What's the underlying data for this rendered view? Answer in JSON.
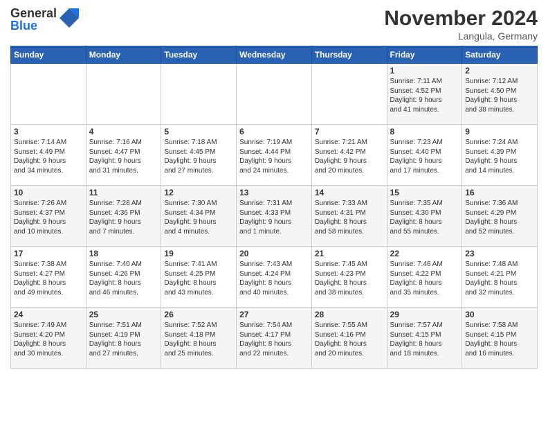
{
  "logo": {
    "general": "General",
    "blue": "Blue"
  },
  "header": {
    "month": "November 2024",
    "location": "Langula, Germany"
  },
  "weekdays": [
    "Sunday",
    "Monday",
    "Tuesday",
    "Wednesday",
    "Thursday",
    "Friday",
    "Saturday"
  ],
  "weeks": [
    [
      {
        "day": "",
        "info": ""
      },
      {
        "day": "",
        "info": ""
      },
      {
        "day": "",
        "info": ""
      },
      {
        "day": "",
        "info": ""
      },
      {
        "day": "",
        "info": ""
      },
      {
        "day": "1",
        "info": "Sunrise: 7:11 AM\nSunset: 4:52 PM\nDaylight: 9 hours\nand 41 minutes."
      },
      {
        "day": "2",
        "info": "Sunrise: 7:12 AM\nSunset: 4:50 PM\nDaylight: 9 hours\nand 38 minutes."
      }
    ],
    [
      {
        "day": "3",
        "info": "Sunrise: 7:14 AM\nSunset: 4:49 PM\nDaylight: 9 hours\nand 34 minutes."
      },
      {
        "day": "4",
        "info": "Sunrise: 7:16 AM\nSunset: 4:47 PM\nDaylight: 9 hours\nand 31 minutes."
      },
      {
        "day": "5",
        "info": "Sunrise: 7:18 AM\nSunset: 4:45 PM\nDaylight: 9 hours\nand 27 minutes."
      },
      {
        "day": "6",
        "info": "Sunrise: 7:19 AM\nSunset: 4:44 PM\nDaylight: 9 hours\nand 24 minutes."
      },
      {
        "day": "7",
        "info": "Sunrise: 7:21 AM\nSunset: 4:42 PM\nDaylight: 9 hours\nand 20 minutes."
      },
      {
        "day": "8",
        "info": "Sunrise: 7:23 AM\nSunset: 4:40 PM\nDaylight: 9 hours\nand 17 minutes."
      },
      {
        "day": "9",
        "info": "Sunrise: 7:24 AM\nSunset: 4:39 PM\nDaylight: 9 hours\nand 14 minutes."
      }
    ],
    [
      {
        "day": "10",
        "info": "Sunrise: 7:26 AM\nSunset: 4:37 PM\nDaylight: 9 hours\nand 10 minutes."
      },
      {
        "day": "11",
        "info": "Sunrise: 7:28 AM\nSunset: 4:36 PM\nDaylight: 9 hours\nand 7 minutes."
      },
      {
        "day": "12",
        "info": "Sunrise: 7:30 AM\nSunset: 4:34 PM\nDaylight: 9 hours\nand 4 minutes."
      },
      {
        "day": "13",
        "info": "Sunrise: 7:31 AM\nSunset: 4:33 PM\nDaylight: 9 hours\nand 1 minute."
      },
      {
        "day": "14",
        "info": "Sunrise: 7:33 AM\nSunset: 4:31 PM\nDaylight: 8 hours\nand 58 minutes."
      },
      {
        "day": "15",
        "info": "Sunrise: 7:35 AM\nSunset: 4:30 PM\nDaylight: 8 hours\nand 55 minutes."
      },
      {
        "day": "16",
        "info": "Sunrise: 7:36 AM\nSunset: 4:29 PM\nDaylight: 8 hours\nand 52 minutes."
      }
    ],
    [
      {
        "day": "17",
        "info": "Sunrise: 7:38 AM\nSunset: 4:27 PM\nDaylight: 8 hours\nand 49 minutes."
      },
      {
        "day": "18",
        "info": "Sunrise: 7:40 AM\nSunset: 4:26 PM\nDaylight: 8 hours\nand 46 minutes."
      },
      {
        "day": "19",
        "info": "Sunrise: 7:41 AM\nSunset: 4:25 PM\nDaylight: 8 hours\nand 43 minutes."
      },
      {
        "day": "20",
        "info": "Sunrise: 7:43 AM\nSunset: 4:24 PM\nDaylight: 8 hours\nand 40 minutes."
      },
      {
        "day": "21",
        "info": "Sunrise: 7:45 AM\nSunset: 4:23 PM\nDaylight: 8 hours\nand 38 minutes."
      },
      {
        "day": "22",
        "info": "Sunrise: 7:46 AM\nSunset: 4:22 PM\nDaylight: 8 hours\nand 35 minutes."
      },
      {
        "day": "23",
        "info": "Sunrise: 7:48 AM\nSunset: 4:21 PM\nDaylight: 8 hours\nand 32 minutes."
      }
    ],
    [
      {
        "day": "24",
        "info": "Sunrise: 7:49 AM\nSunset: 4:20 PM\nDaylight: 8 hours\nand 30 minutes."
      },
      {
        "day": "25",
        "info": "Sunrise: 7:51 AM\nSunset: 4:19 PM\nDaylight: 8 hours\nand 27 minutes."
      },
      {
        "day": "26",
        "info": "Sunrise: 7:52 AM\nSunset: 4:18 PM\nDaylight: 8 hours\nand 25 minutes."
      },
      {
        "day": "27",
        "info": "Sunrise: 7:54 AM\nSunset: 4:17 PM\nDaylight: 8 hours\nand 22 minutes."
      },
      {
        "day": "28",
        "info": "Sunrise: 7:55 AM\nSunset: 4:16 PM\nDaylight: 8 hours\nand 20 minutes."
      },
      {
        "day": "29",
        "info": "Sunrise: 7:57 AM\nSunset: 4:15 PM\nDaylight: 8 hours\nand 18 minutes."
      },
      {
        "day": "30",
        "info": "Sunrise: 7:58 AM\nSunset: 4:15 PM\nDaylight: 8 hours\nand 16 minutes."
      }
    ]
  ]
}
